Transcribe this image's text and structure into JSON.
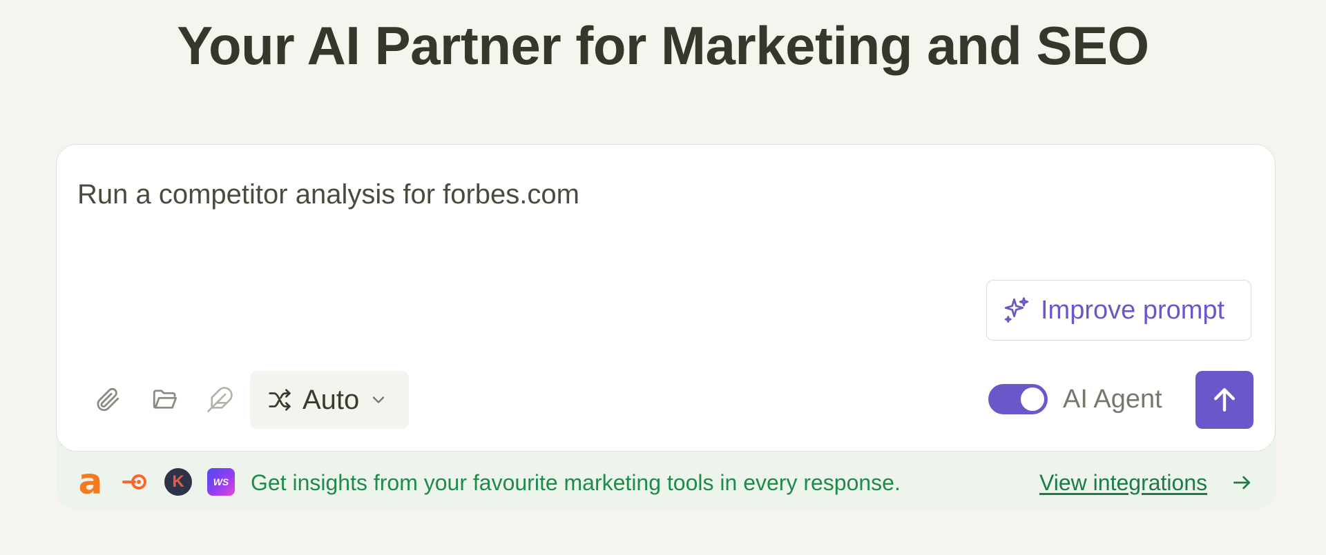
{
  "headline": "Your AI Partner for Marketing and SEO",
  "composer": {
    "prompt_text": "Run a competitor analysis for forbes.com",
    "improve_prompt_label": "Improve prompt",
    "model_select": {
      "selected": "Auto"
    },
    "ai_agent": {
      "label": "AI Agent",
      "enabled": true
    },
    "icons": [
      "paperclip-icon",
      "folder-icon",
      "feather-icon",
      "shuffle-icon",
      "chevron-down-icon",
      "sparkles-icon",
      "arrow-up-icon"
    ]
  },
  "integrations": {
    "logos": [
      "a",
      "semrush",
      "K",
      "WS"
    ],
    "message": "Get insights from your favourite marketing tools in every response.",
    "link_label": "View integrations"
  },
  "colors": {
    "background": "#f5f4ef",
    "accent": "#6a57c9",
    "integration_bar": "#ecf4ec",
    "integration_text": "#1f8a4b"
  }
}
